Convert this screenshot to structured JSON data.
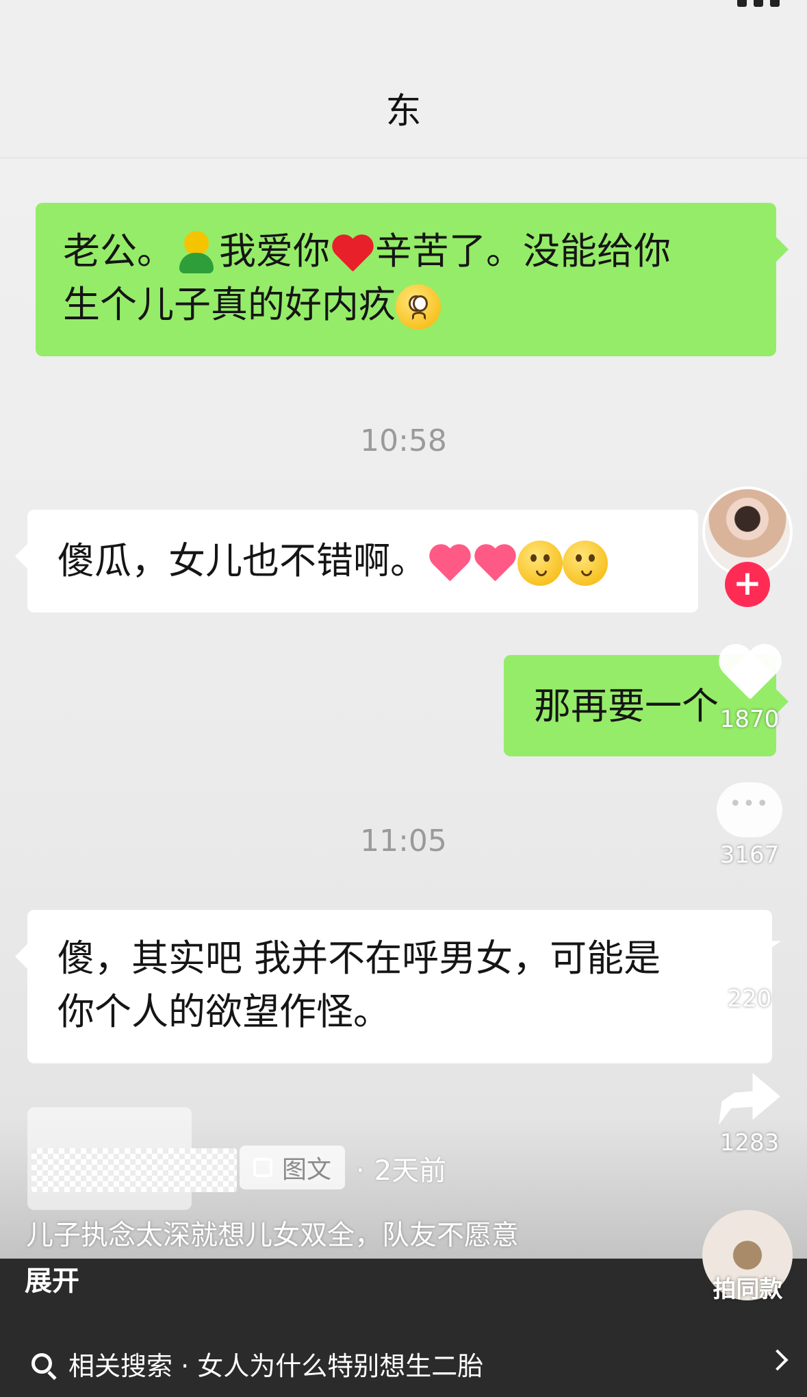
{
  "chat": {
    "title": "东",
    "messages": [
      {
        "side": "me",
        "text_a": "老公。",
        "text_b": "我爱你",
        "text_c": "辛苦了。没能给你",
        "text_d": "生个儿子真的好内疚"
      },
      {
        "side": "time",
        "text": "10:58"
      },
      {
        "side": "other",
        "text": "傻瓜，女儿也不错啊。"
      },
      {
        "side": "me",
        "text": "那再要一个"
      },
      {
        "side": "time",
        "text": "11:05"
      },
      {
        "side": "other",
        "text_line1": "傻，其实吧 我并不在呼男女，可能是",
        "text_line2": "你个人的欲望作怪。"
      }
    ]
  },
  "actions": {
    "likes": "1870",
    "comments": "3167",
    "favorites": "220",
    "shares": "1283",
    "same_style_label": "拍同款"
  },
  "post": {
    "tag_label": "图文",
    "age": "2天前",
    "age_separator": "·",
    "caption": "儿子执念太深就想儿女双全，队友不愿意",
    "expand_label": "展开"
  },
  "search": {
    "label": "相关搜索 · 女人为什么特别想生二胎"
  },
  "colors": {
    "my_bubble": "#95ec69",
    "other_bubble": "#ffffff",
    "follow_button": "#fe2c55"
  },
  "icons": [
    "hug-emoji",
    "red-heart-emoji",
    "pleading-face-emoji",
    "pink-heart-emoji",
    "kissing-face-emoji",
    "heart-icon",
    "comment-icon",
    "star-icon",
    "share-icon",
    "search-icon",
    "chevron-right-icon"
  ]
}
